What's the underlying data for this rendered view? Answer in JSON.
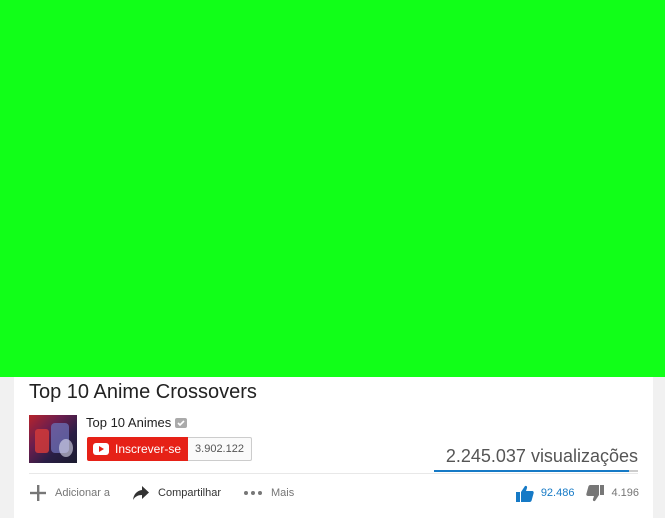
{
  "video": {
    "background_color": "#11ff18",
    "title": "Top 10 Anime Crossovers"
  },
  "channel": {
    "name": "Top 10 Animes",
    "verified_icon": "verified-badge-icon",
    "subscribe_label": "Inscrever-se",
    "subscriber_count": "3.902.122"
  },
  "stats": {
    "views": "2.245.037 visualizações",
    "likes": "92.486",
    "dislikes": "4.196",
    "like_ratio": 0.9566
  },
  "actions": {
    "add_label": "Adicionar a",
    "share_label": "Compartilhar",
    "more_label": "Mais"
  },
  "colors": {
    "subscribe_red": "#e62117",
    "like_blue": "#167ac6",
    "green_screen": "#11ff18"
  }
}
